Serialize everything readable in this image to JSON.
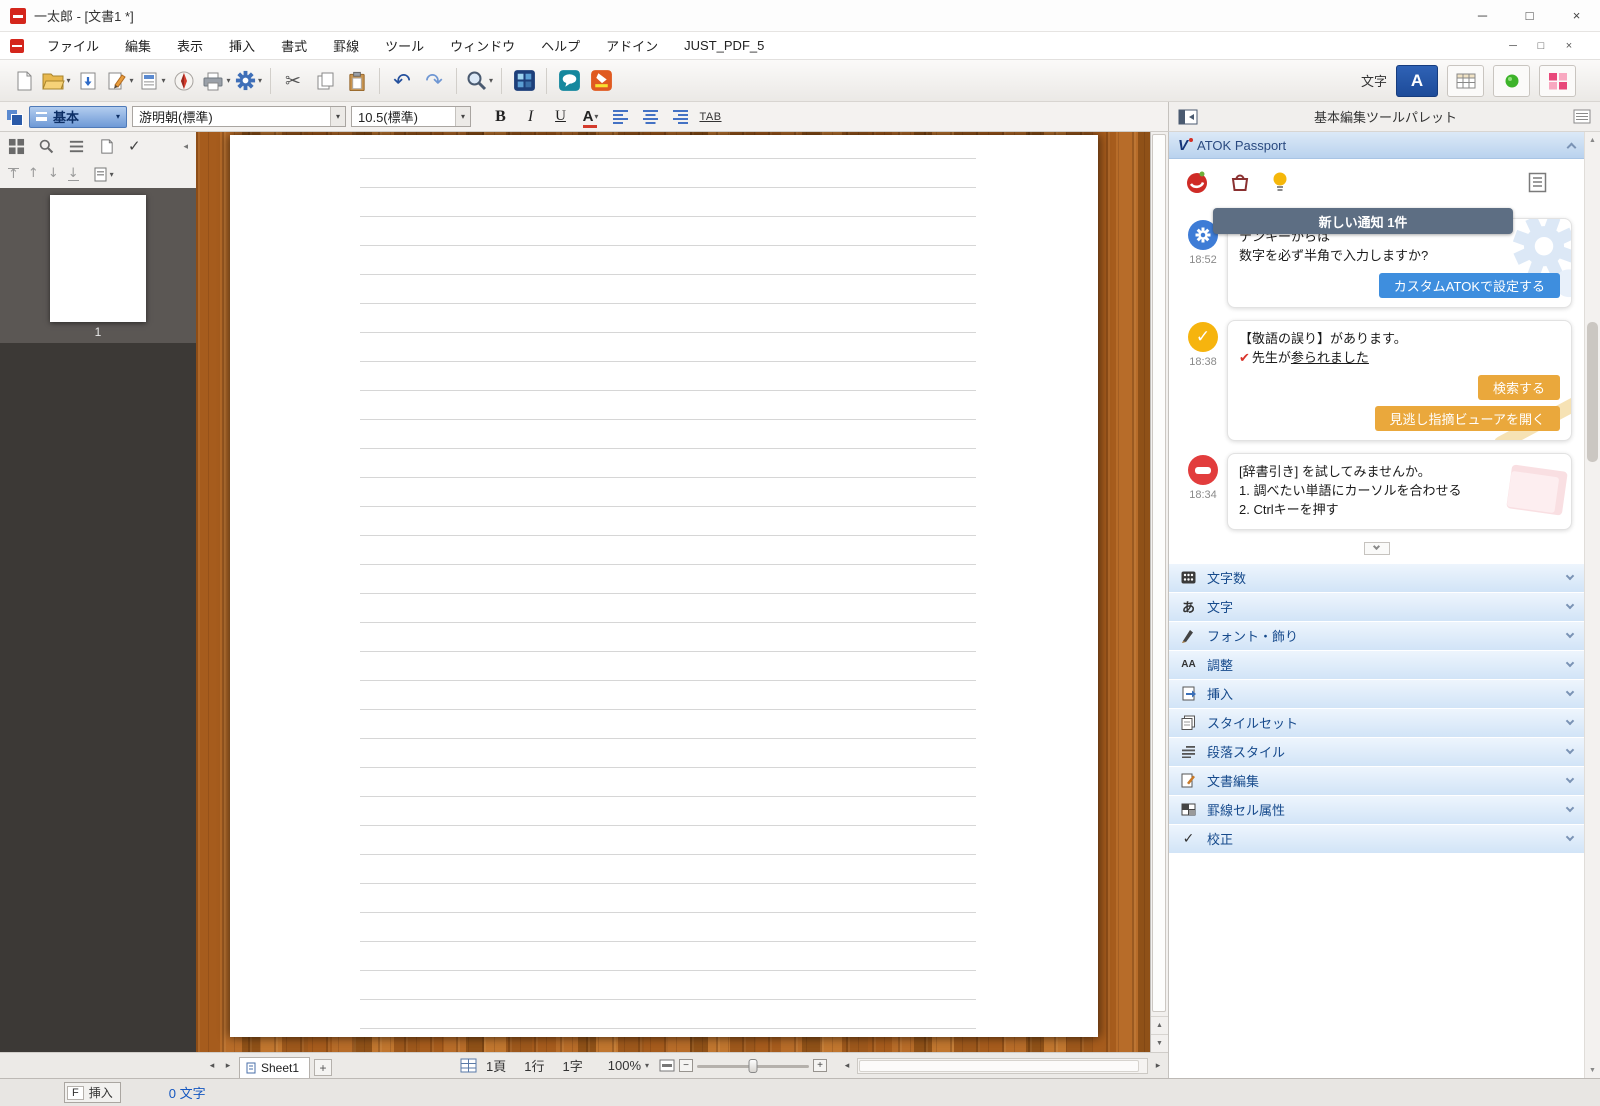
{
  "icons": {
    "caret_down": "▾",
    "chevron_left": "◂",
    "chevron_right": "▸",
    "scroll_up": "▲",
    "scroll_down": "▼",
    "undo": "↶",
    "redo": "↷",
    "scissors": "✂",
    "check": "✓",
    "nav_up": "↑",
    "nav_down": "↓"
  },
  "window": {
    "title": "一太郎 - [文書1 *]",
    "minimize": "─",
    "maximize": "□",
    "close": "×"
  },
  "menu_bar": {
    "items": [
      "ファイル",
      "編集",
      "表示",
      "挿入",
      "書式",
      "罫線",
      "ツール",
      "ウィンドウ",
      "ヘルプ",
      "アドイン",
      "JUST_PDF_5"
    ],
    "doc_minimize": "─",
    "doc_restore": "□",
    "doc_close": "×"
  },
  "toolbar": {
    "mode_label": "文字",
    "char_mode_button": "A"
  },
  "format_bar": {
    "style_preset": "基本",
    "font_name": "游明朝(標準)",
    "font_size": "10.5(標準)",
    "bold": "B",
    "italic": "I",
    "underline": "U",
    "font_color": "A",
    "tab": "TAB"
  },
  "page_sidebar": {
    "thumbnail_page_number": "1"
  },
  "tool_palette": {
    "header_title": "基本編集ツールパレット",
    "atok": {
      "title": "ATOK Passport",
      "notification_badge": "新しい通知 1件",
      "notifications": [
        {
          "time": "18:52",
          "line1": "テンキーからは",
          "line2": "数字を必ず半角で入力しますか?",
          "action": "カスタムATOKで設定する"
        },
        {
          "time": "18:38",
          "line1": "【敬語の誤り】があります。",
          "check": "✔",
          "line2_text": "先生が",
          "line2_underlined": "参られました",
          "action1": "検索する",
          "action2": "見逃し指摘ビューアを開く"
        },
        {
          "time": "18:34",
          "line1": "[辞書引き] を試してみませんか。",
          "line2": "1. 調べたい単語にカーソルを合わせる",
          "line3": "2. Ctrlキーを押す"
        }
      ]
    },
    "sections": [
      {
        "label": "文字数"
      },
      {
        "label": "文字"
      },
      {
        "label": "フォント・飾り"
      },
      {
        "label": "調整"
      },
      {
        "label": "挿入"
      },
      {
        "label": "スタイルセット"
      },
      {
        "label": "段落スタイル"
      },
      {
        "label": "文書編集"
      },
      {
        "label": "罫線セル属性"
      },
      {
        "label": "校正"
      }
    ]
  },
  "sheet_bar": {
    "sheet_tab": "Sheet1",
    "add_sheet": "+",
    "page_indicator": "1頁",
    "line_indicator": "1行",
    "char_indicator": "1字",
    "zoom_level": "100%"
  },
  "status_bar": {
    "insert_key": "F",
    "insert_mode": "挿入",
    "char_count": "0 文字"
  }
}
